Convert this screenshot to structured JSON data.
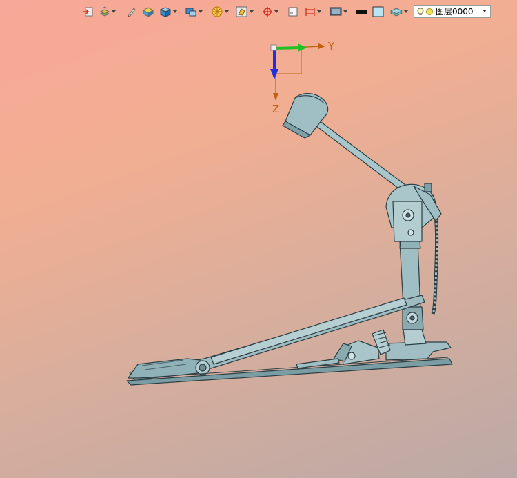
{
  "toolbar": {
    "buttons": [
      {
        "name": "exit-icon",
        "has_dropdown": false
      },
      {
        "name": "layer-stack-icon",
        "has_dropdown": true
      },
      {
        "name": "pen-icon",
        "has_dropdown": false
      },
      {
        "name": "material-icon",
        "has_dropdown": false
      },
      {
        "name": "solid-view-icon",
        "has_dropdown": true
      },
      {
        "name": "view-orientation-icon",
        "has_dropdown": true
      },
      {
        "name": "render-mode-icon",
        "has_dropdown": true
      },
      {
        "name": "section-view-icon",
        "has_dropdown": true
      },
      {
        "name": "snap-point-icon",
        "has_dropdown": true
      },
      {
        "name": "frame-icon",
        "has_dropdown": false
      },
      {
        "name": "dimension-icon",
        "has_dropdown": true
      },
      {
        "name": "display-icon",
        "has_dropdown": true
      },
      {
        "name": "line-weight-icon",
        "has_dropdown": false
      },
      {
        "name": "color-swatch-icon",
        "has_dropdown": false
      },
      {
        "name": "layer-manager-icon",
        "has_dropdown": true
      }
    ],
    "layer": {
      "current": "图层0000"
    }
  },
  "axes": {
    "y_label": "Y",
    "z_label": "Z"
  },
  "colors": {
    "model": "#8fb2b8",
    "model_edge": "#2b3e44",
    "axis_y": "#22c022",
    "axis_z": "#2030e0",
    "axis_ref": "#c06010"
  }
}
